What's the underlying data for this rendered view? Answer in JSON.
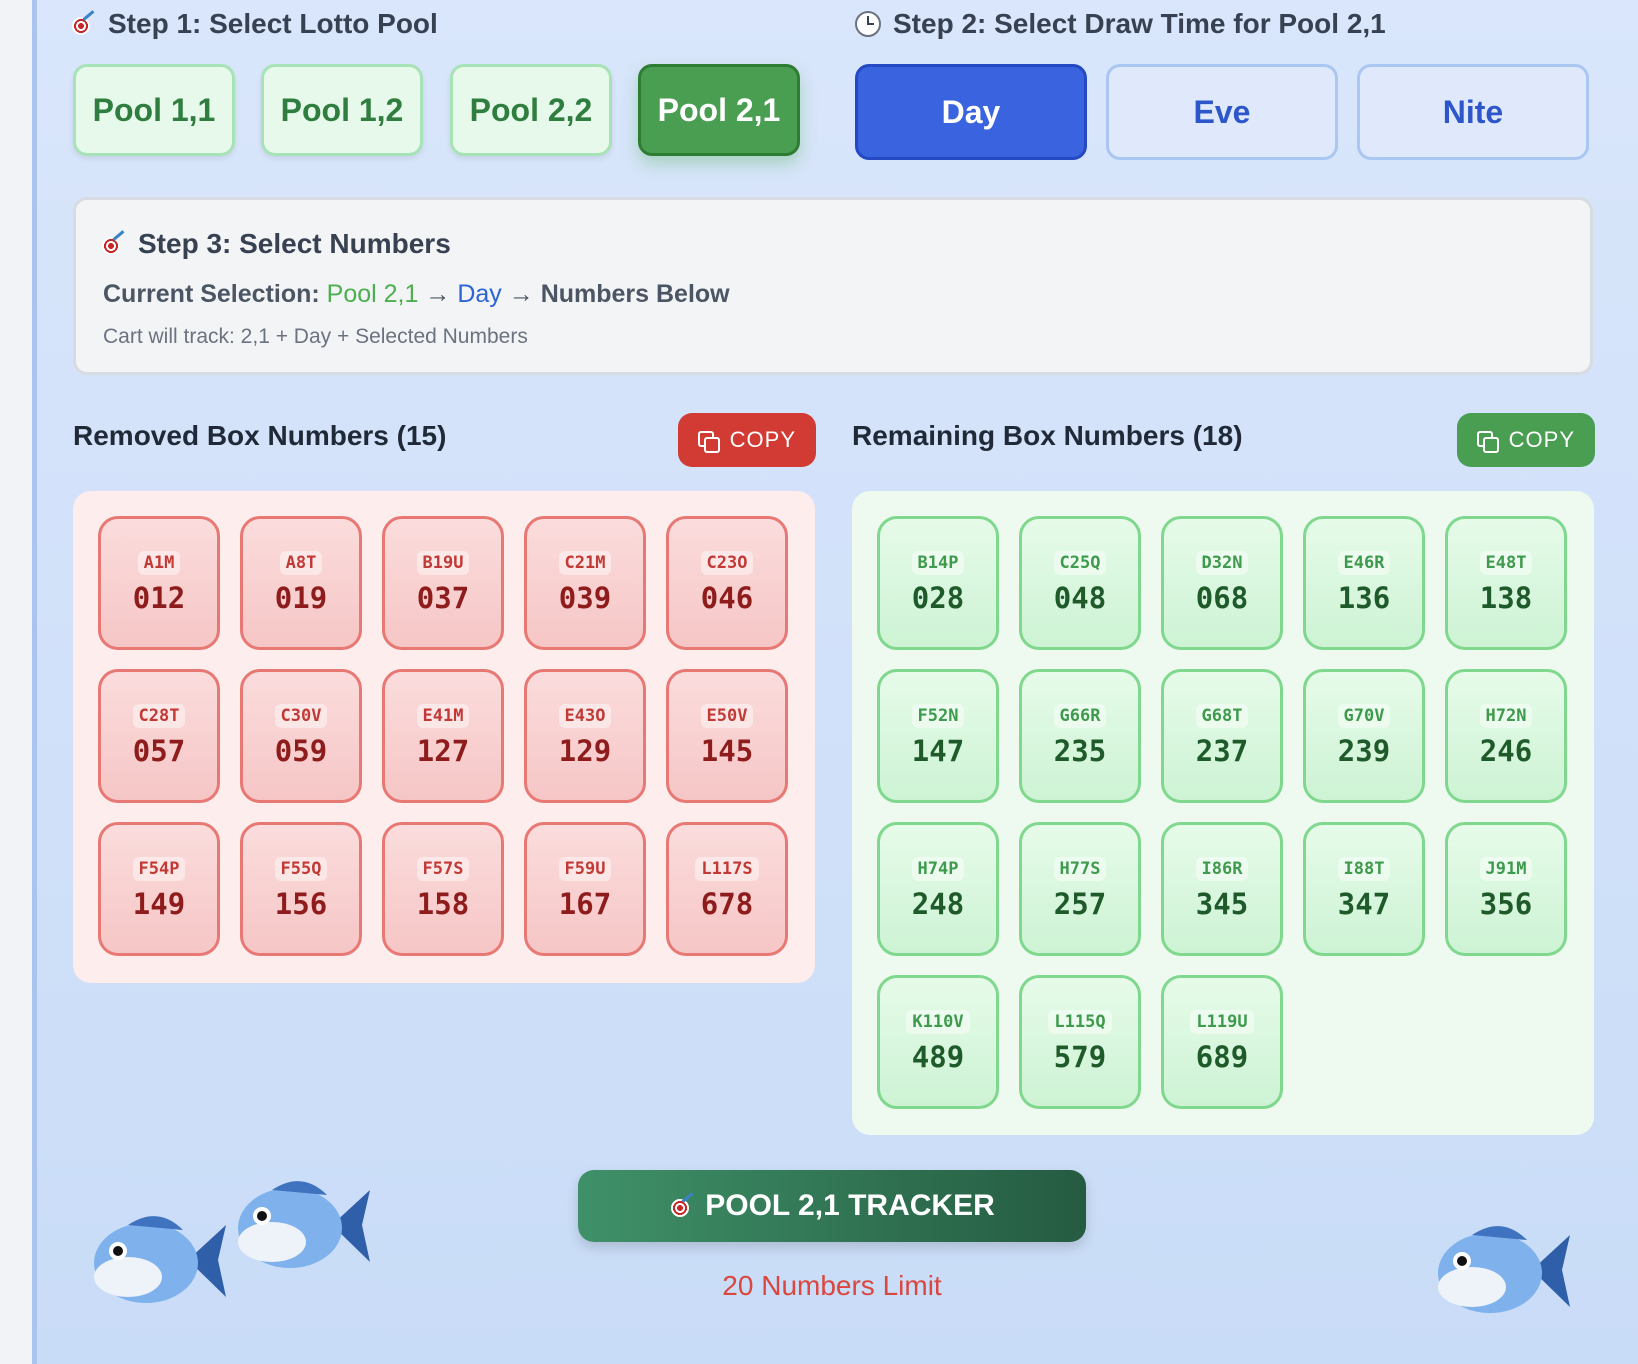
{
  "step1": {
    "title": "Step 1: Select Lotto Pool",
    "pools": [
      "Pool 1,1",
      "Pool 1,2",
      "Pool 2,2",
      "Pool 2,1"
    ],
    "active_pool": "Pool 2,1"
  },
  "step2": {
    "title": "Step 2: Select Draw Time for Pool 2,1",
    "times": [
      "Day",
      "Eve",
      "Nite"
    ],
    "active_time": "Day"
  },
  "step3": {
    "title": "Step 3: Select Numbers",
    "selection_label": "Current Selection:",
    "selection_pool": "Pool 2,1",
    "arrow": "→",
    "selection_time": "Day",
    "selection_tail": "Numbers Below",
    "cart_note": "Cart will track: 2,1 + Day + Selected Numbers"
  },
  "removed": {
    "title": "Removed Box Numbers (15)",
    "copy_label": "COPY",
    "items": [
      {
        "code": "A1M",
        "num": "012"
      },
      {
        "code": "A8T",
        "num": "019"
      },
      {
        "code": "B19U",
        "num": "037"
      },
      {
        "code": "C21M",
        "num": "039"
      },
      {
        "code": "C23O",
        "num": "046"
      },
      {
        "code": "C28T",
        "num": "057"
      },
      {
        "code": "C30V",
        "num": "059"
      },
      {
        "code": "E41M",
        "num": "127"
      },
      {
        "code": "E43O",
        "num": "129"
      },
      {
        "code": "E50V",
        "num": "145"
      },
      {
        "code": "F54P",
        "num": "149"
      },
      {
        "code": "F55Q",
        "num": "156"
      },
      {
        "code": "F57S",
        "num": "158"
      },
      {
        "code": "F59U",
        "num": "167"
      },
      {
        "code": "L117S",
        "num": "678"
      }
    ]
  },
  "remaining": {
    "title": "Remaining Box Numbers (18)",
    "copy_label": "COPY",
    "items": [
      {
        "code": "B14P",
        "num": "028"
      },
      {
        "code": "C25Q",
        "num": "048"
      },
      {
        "code": "D32N",
        "num": "068"
      },
      {
        "code": "E46R",
        "num": "136"
      },
      {
        "code": "E48T",
        "num": "138"
      },
      {
        "code": "F52N",
        "num": "147"
      },
      {
        "code": "G66R",
        "num": "235"
      },
      {
        "code": "G68T",
        "num": "237"
      },
      {
        "code": "G70V",
        "num": "239"
      },
      {
        "code": "H72N",
        "num": "246"
      },
      {
        "code": "H74P",
        "num": "248"
      },
      {
        "code": "H77S",
        "num": "257"
      },
      {
        "code": "I86R",
        "num": "345"
      },
      {
        "code": "I88T",
        "num": "347"
      },
      {
        "code": "J91M",
        "num": "356"
      },
      {
        "code": "K110V",
        "num": "489"
      },
      {
        "code": "L115Q",
        "num": "579"
      },
      {
        "code": "L119U",
        "num": "689"
      }
    ]
  },
  "tracker": {
    "label": "POOL 2,1 TRACKER",
    "limit": "20 Numbers Limit"
  },
  "icons": {
    "dart": "dart-target-icon",
    "clock": "clock-icon",
    "copy": "copy-icon",
    "fish": "fish-icon"
  },
  "colors": {
    "pool_active": "#4a9e52",
    "time_active": "#3a63e0",
    "removed": "#d23b33",
    "remaining": "#4a9e52",
    "limit": "#d9473f"
  }
}
